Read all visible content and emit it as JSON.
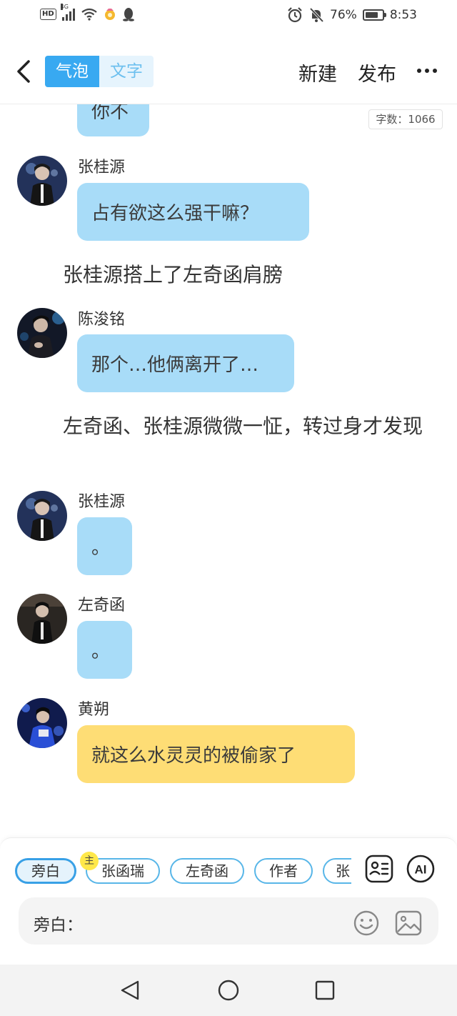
{
  "status_bar": {
    "hd": "HD",
    "network": "4G",
    "battery_text": "76%",
    "battery_level": 0.76,
    "time": "8:53"
  },
  "header": {
    "mode_tabs": [
      "气泡",
      "文字"
    ],
    "active_mode": "气泡",
    "new_label": "新建",
    "publish_label": "发布"
  },
  "word_count": "字数：1066",
  "messages": [
    {
      "type": "bubble",
      "speaker": "",
      "text": "你不",
      "color": "#a8dcf8",
      "cut_top": true
    },
    {
      "type": "bubble",
      "speaker": "张桂源",
      "text": "占有欲这么强干嘛？",
      "color": "#a8dcf8"
    },
    {
      "type": "narration",
      "text": "张桂源搭上了左奇函肩膀"
    },
    {
      "type": "bubble",
      "speaker": "陈浚铭",
      "text": "那个…他俩离开了…",
      "color": "#a8dcf8"
    },
    {
      "type": "narration",
      "text": "左奇函、张桂源微微一怔，转过身才发现"
    },
    {
      "type": "bubble",
      "speaker": "张桂源",
      "text": "。",
      "color": "#a8dcf8"
    },
    {
      "type": "bubble",
      "speaker": "左奇函",
      "text": "。",
      "color": "#a8dcf8"
    },
    {
      "type": "bubble",
      "speaker": "黄朔",
      "text": "就这么水灵灵的被偷家了",
      "color": "#fedd75"
    }
  ],
  "role_chips": [
    {
      "label": "旁白",
      "selected": true
    },
    {
      "label": "张函瑞",
      "selected": false,
      "badge": "主"
    },
    {
      "label": "左奇函",
      "selected": false
    },
    {
      "label": "作者",
      "selected": false
    },
    {
      "label": "张",
      "selected": false
    }
  ],
  "toolbar_icons": {
    "role_card": "role-card-icon",
    "ai": "AI"
  },
  "input": {
    "label": "旁白："
  },
  "nav_icons": [
    "back-triangle-icon",
    "home-circle-icon",
    "recents-square-icon"
  ],
  "colors": {
    "accent": "#38a9f1",
    "bubble_blue": "#a8dcf8",
    "bubble_yellow": "#fedd75"
  }
}
